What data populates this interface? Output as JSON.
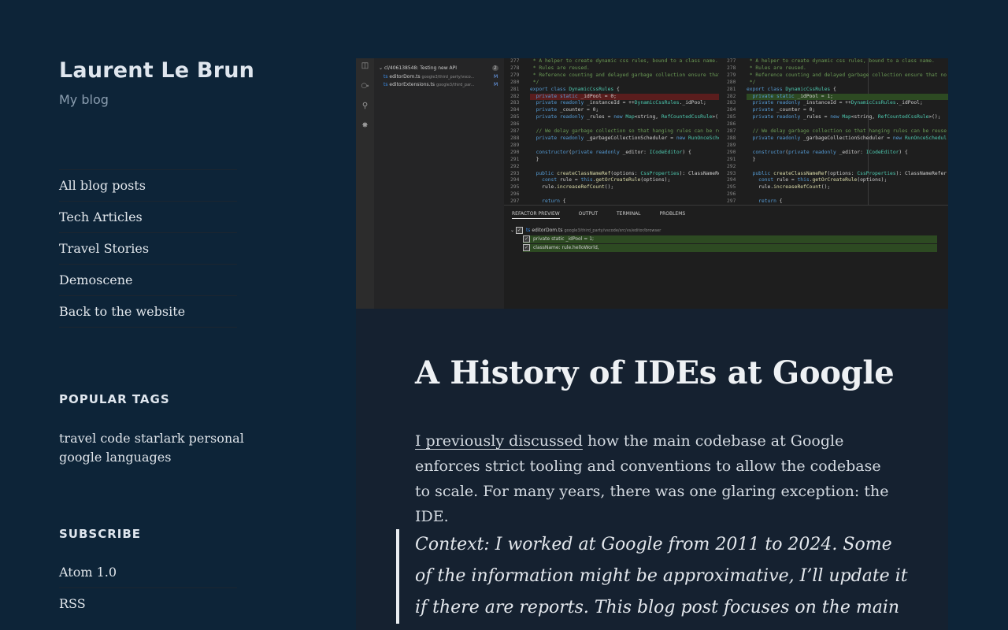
{
  "site": {
    "title": "Laurent Le Brun",
    "description": "My blog"
  },
  "nav": {
    "items": [
      {
        "label": "All blog posts"
      },
      {
        "label": "Tech Articles"
      },
      {
        "label": "Travel Stories"
      },
      {
        "label": "Demoscene"
      },
      {
        "label": "Back to the website"
      }
    ]
  },
  "popular_tags": {
    "title": "POPULAR TAGS",
    "tags": [
      "travel",
      "code",
      "starlark",
      "personal",
      "google",
      "languages"
    ]
  },
  "subscribe": {
    "title": "SUBSCRIBE",
    "items": [
      {
        "label": "Atom 1.0"
      },
      {
        "label": "RSS"
      }
    ]
  },
  "hero": {
    "sidepanel": {
      "changelist": "cl/406138548: Testing new API",
      "changelist_count": "2",
      "files": [
        {
          "name": "editorDom.ts",
          "path": "google3/third_party/vsco...",
          "status": "M"
        },
        {
          "name": "editorExtensions.ts",
          "path": "google3/third_par...",
          "status": "M"
        }
      ]
    },
    "panel": {
      "tabs": [
        "REFACTOR PREVIEW",
        "OUTPUT",
        "TERMINAL",
        "PROBLEMS"
      ],
      "file": "editorDom.ts",
      "file_path": "google3/third_party/vscode/src/vs/editor/browser",
      "changes": [
        "private static _idPool = 1;",
        "className: rule.helloWorld,"
      ]
    },
    "editor": {
      "line_numbers": [
        "277",
        "278",
        "279",
        "280",
        "281",
        "282",
        "283",
        "284",
        "285",
        "286",
        "287",
        "288",
        "289",
        "290",
        "291",
        "292",
        "293",
        "294",
        "295",
        "296",
        "297"
      ],
      "left_lines": [
        " * A helper to create dynamic css rules, bound to a class name.",
        " * Rules are reused.",
        " * Reference counting and delayed garbage collection ensure that no",
        " */",
        "export class DynamicCssRules {",
        "  private static _idPool = 0;",
        "  private readonly _instanceId = ++DynamicCssRules._idPool;",
        "  private _counter = 0;",
        "  private readonly _rules = new Map<string, RefCountedCssRule>();",
        "",
        "  // We delay garbage collection so that hanging rules can be reus",
        "  private readonly _garbageCollectionScheduler = new RunOnceSchedul",
        "",
        "  constructor(private readonly _editor: ICodeEditor) {",
        "  }",
        "",
        "  public createClassNameRef(options: CssProperties): ClassNameRefer",
        "    const rule = this.getOrCreateRule(options);",
        "    rule.increaseRefCount();",
        "",
        "    return {"
      ],
      "right_lines": [
        " * A helper to create dynamic css rules, bound to a class name.",
        " * Rules are reused.",
        " * Reference counting and delayed garbage collection ensure that no",
        " */",
        "export class DynamicCssRules {",
        "  private static _idPool = 1;",
        "  private readonly _instanceId = ++DynamicCssRules._idPool;",
        "  private _counter = 0;",
        "  private readonly _rules = new Map<string, RefCountedCssRule>();",
        "",
        "  // We delay garbage collection so that hanging rules can be reuse",
        "  private readonly _garbageCollectionScheduler = new RunOnceSchedul",
        "",
        "  constructor(private readonly _editor: ICodeEditor) {",
        "  }",
        "",
        "  public createClassNameRef(options: CssProperties): ClassNameRefer",
        "    const rule = this.getOrCreateRule(options);",
        "    rule.increaseRefCount();",
        "",
        "    return {"
      ]
    }
  },
  "article": {
    "title": "A History of IDEs at Google",
    "intro_link": "I previously discussed",
    "intro_rest": " how the main codebase at Google enforces strict tooling and conventions to allow the codebase to scale. For many years, there was one glaring exception: the IDE.",
    "quote": "Context: I worked at Google from 2011 to 2024. Some of the information might be approximative, I’ll update it if there are reports. This blog post focuses on the main"
  }
}
